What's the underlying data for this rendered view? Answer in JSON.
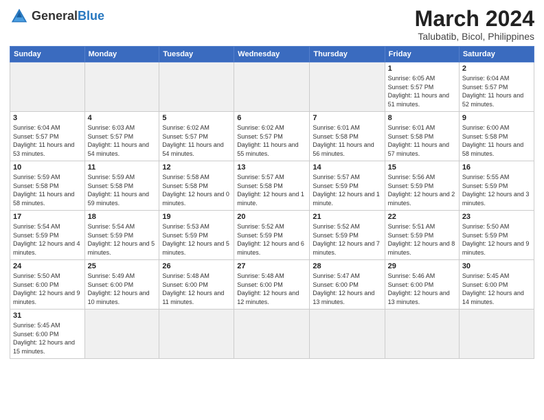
{
  "logo": {
    "text_regular": "General",
    "text_bold": "Blue"
  },
  "header": {
    "month_year": "March 2024",
    "location": "Talubatib, Bicol, Philippines"
  },
  "weekdays": [
    "Sunday",
    "Monday",
    "Tuesday",
    "Wednesday",
    "Thursday",
    "Friday",
    "Saturday"
  ],
  "weeks": [
    [
      {
        "day": "",
        "empty": true
      },
      {
        "day": "",
        "empty": true
      },
      {
        "day": "",
        "empty": true
      },
      {
        "day": "",
        "empty": true
      },
      {
        "day": "",
        "empty": true
      },
      {
        "day": "1",
        "info": "Sunrise: 6:05 AM\nSunset: 5:57 PM\nDaylight: 11 hours\nand 51 minutes."
      },
      {
        "day": "2",
        "info": "Sunrise: 6:04 AM\nSunset: 5:57 PM\nDaylight: 11 hours\nand 52 minutes."
      }
    ],
    [
      {
        "day": "3",
        "info": "Sunrise: 6:04 AM\nSunset: 5:57 PM\nDaylight: 11 hours\nand 53 minutes."
      },
      {
        "day": "4",
        "info": "Sunrise: 6:03 AM\nSunset: 5:57 PM\nDaylight: 11 hours\nand 54 minutes."
      },
      {
        "day": "5",
        "info": "Sunrise: 6:02 AM\nSunset: 5:57 PM\nDaylight: 11 hours\nand 54 minutes."
      },
      {
        "day": "6",
        "info": "Sunrise: 6:02 AM\nSunset: 5:57 PM\nDaylight: 11 hours\nand 55 minutes."
      },
      {
        "day": "7",
        "info": "Sunrise: 6:01 AM\nSunset: 5:58 PM\nDaylight: 11 hours\nand 56 minutes."
      },
      {
        "day": "8",
        "info": "Sunrise: 6:01 AM\nSunset: 5:58 PM\nDaylight: 11 hours\nand 57 minutes."
      },
      {
        "day": "9",
        "info": "Sunrise: 6:00 AM\nSunset: 5:58 PM\nDaylight: 11 hours\nand 58 minutes."
      }
    ],
    [
      {
        "day": "10",
        "info": "Sunrise: 5:59 AM\nSunset: 5:58 PM\nDaylight: 11 hours\nand 58 minutes."
      },
      {
        "day": "11",
        "info": "Sunrise: 5:59 AM\nSunset: 5:58 PM\nDaylight: 11 hours\nand 59 minutes."
      },
      {
        "day": "12",
        "info": "Sunrise: 5:58 AM\nSunset: 5:58 PM\nDaylight: 12 hours\nand 0 minutes."
      },
      {
        "day": "13",
        "info": "Sunrise: 5:57 AM\nSunset: 5:58 PM\nDaylight: 12 hours\nand 1 minute."
      },
      {
        "day": "14",
        "info": "Sunrise: 5:57 AM\nSunset: 5:59 PM\nDaylight: 12 hours\nand 1 minute."
      },
      {
        "day": "15",
        "info": "Sunrise: 5:56 AM\nSunset: 5:59 PM\nDaylight: 12 hours\nand 2 minutes."
      },
      {
        "day": "16",
        "info": "Sunrise: 5:55 AM\nSunset: 5:59 PM\nDaylight: 12 hours\nand 3 minutes."
      }
    ],
    [
      {
        "day": "17",
        "info": "Sunrise: 5:54 AM\nSunset: 5:59 PM\nDaylight: 12 hours\nand 4 minutes."
      },
      {
        "day": "18",
        "info": "Sunrise: 5:54 AM\nSunset: 5:59 PM\nDaylight: 12 hours\nand 5 minutes."
      },
      {
        "day": "19",
        "info": "Sunrise: 5:53 AM\nSunset: 5:59 PM\nDaylight: 12 hours\nand 5 minutes."
      },
      {
        "day": "20",
        "info": "Sunrise: 5:52 AM\nSunset: 5:59 PM\nDaylight: 12 hours\nand 6 minutes."
      },
      {
        "day": "21",
        "info": "Sunrise: 5:52 AM\nSunset: 5:59 PM\nDaylight: 12 hours\nand 7 minutes."
      },
      {
        "day": "22",
        "info": "Sunrise: 5:51 AM\nSunset: 5:59 PM\nDaylight: 12 hours\nand 8 minutes."
      },
      {
        "day": "23",
        "info": "Sunrise: 5:50 AM\nSunset: 5:59 PM\nDaylight: 12 hours\nand 9 minutes."
      }
    ],
    [
      {
        "day": "24",
        "info": "Sunrise: 5:50 AM\nSunset: 6:00 PM\nDaylight: 12 hours\nand 9 minutes."
      },
      {
        "day": "25",
        "info": "Sunrise: 5:49 AM\nSunset: 6:00 PM\nDaylight: 12 hours\nand 10 minutes."
      },
      {
        "day": "26",
        "info": "Sunrise: 5:48 AM\nSunset: 6:00 PM\nDaylight: 12 hours\nand 11 minutes."
      },
      {
        "day": "27",
        "info": "Sunrise: 5:48 AM\nSunset: 6:00 PM\nDaylight: 12 hours\nand 12 minutes."
      },
      {
        "day": "28",
        "info": "Sunrise: 5:47 AM\nSunset: 6:00 PM\nDaylight: 12 hours\nand 13 minutes."
      },
      {
        "day": "29",
        "info": "Sunrise: 5:46 AM\nSunset: 6:00 PM\nDaylight: 12 hours\nand 13 minutes."
      },
      {
        "day": "30",
        "info": "Sunrise: 5:45 AM\nSunset: 6:00 PM\nDaylight: 12 hours\nand 14 minutes."
      }
    ],
    [
      {
        "day": "31",
        "info": "Sunrise: 5:45 AM\nSunset: 6:00 PM\nDaylight: 12 hours\nand 15 minutes."
      },
      {
        "day": "",
        "empty": true
      },
      {
        "day": "",
        "empty": true
      },
      {
        "day": "",
        "empty": true
      },
      {
        "day": "",
        "empty": true
      },
      {
        "day": "",
        "empty": true
      },
      {
        "day": "",
        "empty": true
      }
    ]
  ]
}
